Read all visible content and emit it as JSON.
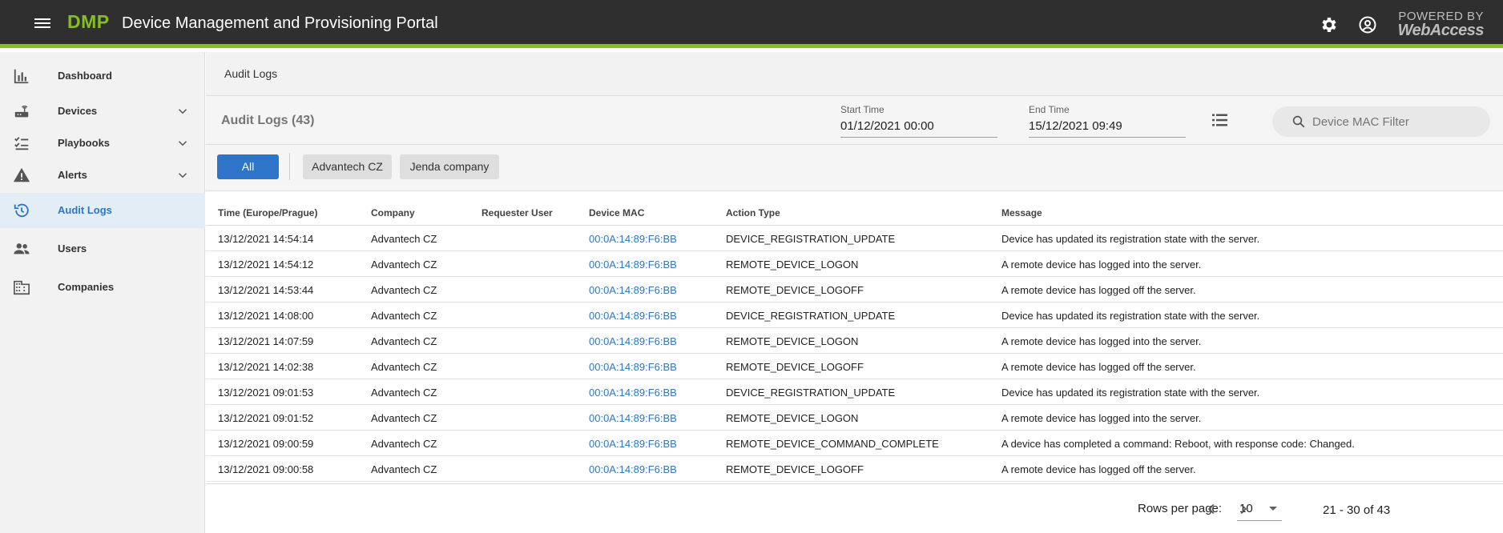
{
  "header": {
    "logo": "DMP",
    "title": "Device Management and Provisioning Portal",
    "powered_line1": "POWERED BY",
    "powered_line2": "WebAccess",
    "icons": [
      "menu-icon",
      "gear-icon",
      "account-circle-icon"
    ],
    "accent_color": "#86bc25"
  },
  "sidebar": {
    "items": [
      {
        "label": "Dashboard",
        "icon": "bar-chart-icon",
        "expandable": false,
        "active": false
      },
      {
        "label": "Devices",
        "icon": "router-icon",
        "expandable": true,
        "active": false
      },
      {
        "label": "Playbooks",
        "icon": "checklist-icon",
        "expandable": true,
        "active": false
      },
      {
        "label": "Alerts",
        "icon": "warning-icon",
        "expandable": true,
        "active": false
      },
      {
        "label": "Audit Logs",
        "icon": "history-icon",
        "expandable": false,
        "active": true
      },
      {
        "label": "Users",
        "icon": "people-icon",
        "expandable": false,
        "active": false
      },
      {
        "label": "Companies",
        "icon": "building-icon",
        "expandable": false,
        "active": false
      }
    ]
  },
  "breadcrumb": "Audit Logs",
  "toolbar": {
    "title": "Audit Logs (43)",
    "start_label": "Start Time",
    "start_value": "01/12/2021 00:00",
    "end_label": "End Time",
    "end_value": "15/12/2021 09:49",
    "search_placeholder": "Device MAC Filter"
  },
  "filters": {
    "all": "All",
    "companies": [
      "Advantech CZ",
      "Jenda company"
    ]
  },
  "table": {
    "columns": [
      "Time (Europe/Prague)",
      "Company",
      "Requester User",
      "Device MAC",
      "Action Type",
      "Message"
    ],
    "rows": [
      {
        "time": "13/12/2021 14:54:14",
        "company": "Advantech CZ",
        "user": "",
        "mac": "00:0A:14:89:F6:BB",
        "action": "DEVICE_REGISTRATION_UPDATE",
        "message": "Device has updated its registration state with the server."
      },
      {
        "time": "13/12/2021 14:54:12",
        "company": "Advantech CZ",
        "user": "",
        "mac": "00:0A:14:89:F6:BB",
        "action": "REMOTE_DEVICE_LOGON",
        "message": "A remote device has logged into the server."
      },
      {
        "time": "13/12/2021 14:53:44",
        "company": "Advantech CZ",
        "user": "",
        "mac": "00:0A:14:89:F6:BB",
        "action": "REMOTE_DEVICE_LOGOFF",
        "message": "A remote device has logged off the server."
      },
      {
        "time": "13/12/2021 14:08:00",
        "company": "Advantech CZ",
        "user": "",
        "mac": "00:0A:14:89:F6:BB",
        "action": "DEVICE_REGISTRATION_UPDATE",
        "message": "Device has updated its registration state with the server."
      },
      {
        "time": "13/12/2021 14:07:59",
        "company": "Advantech CZ",
        "user": "",
        "mac": "00:0A:14:89:F6:BB",
        "action": "REMOTE_DEVICE_LOGON",
        "message": "A remote device has logged into the server."
      },
      {
        "time": "13/12/2021 14:02:38",
        "company": "Advantech CZ",
        "user": "",
        "mac": "00:0A:14:89:F6:BB",
        "action": "REMOTE_DEVICE_LOGOFF",
        "message": "A remote device has logged off the server."
      },
      {
        "time": "13/12/2021 09:01:53",
        "company": "Advantech CZ",
        "user": "",
        "mac": "00:0A:14:89:F6:BB",
        "action": "DEVICE_REGISTRATION_UPDATE",
        "message": "Device has updated its registration state with the server."
      },
      {
        "time": "13/12/2021 09:01:52",
        "company": "Advantech CZ",
        "user": "",
        "mac": "00:0A:14:89:F6:BB",
        "action": "REMOTE_DEVICE_LOGON",
        "message": "A remote device has logged into the server."
      },
      {
        "time": "13/12/2021 09:00:59",
        "company": "Advantech CZ",
        "user": "",
        "mac": "00:0A:14:89:F6:BB",
        "action": "REMOTE_DEVICE_COMMAND_COMPLETE",
        "message": "A device has completed a command: Reboot, with response code: Changed."
      },
      {
        "time": "13/12/2021 09:00:58",
        "company": "Advantech CZ",
        "user": "",
        "mac": "00:0A:14:89:F6:BB",
        "action": "REMOTE_DEVICE_LOGOFF",
        "message": "A remote device has logged off the server."
      }
    ]
  },
  "pagination": {
    "rows_per_page_label": "Rows per page:",
    "rows_per_page": "10",
    "range": "21 - 30 of 43"
  }
}
